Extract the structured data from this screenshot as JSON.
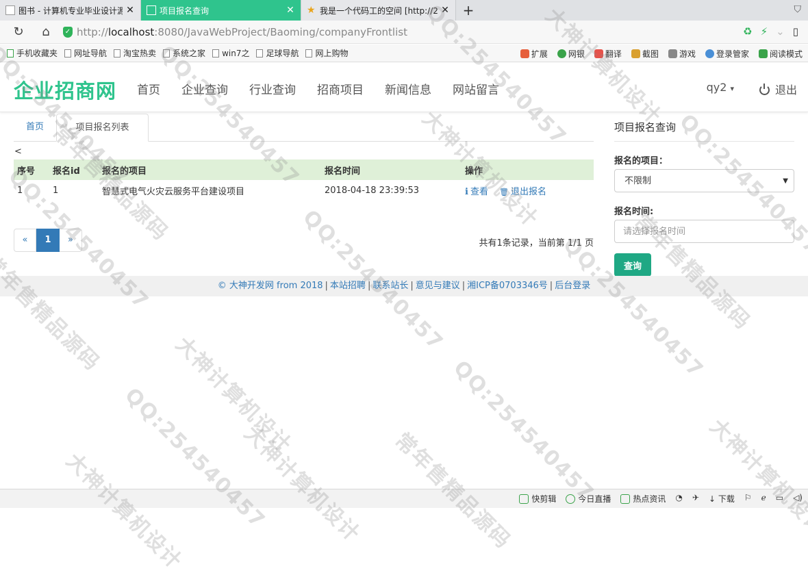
{
  "browser": {
    "tabs": [
      {
        "title": "图书 - 计算机专业毕业设计源码",
        "favicon": "document-icon"
      },
      {
        "title": "项目报名查询",
        "favicon": "page-icon"
      },
      {
        "title": "我是一个代码工的空间 [http://2",
        "favicon": "star-icon"
      }
    ],
    "new_tab": "+",
    "url": {
      "scheme": "http://",
      "host": "localhost",
      "rest": ":8080/JavaWebProject/Baoming/companyFrontlist"
    },
    "bookmarks": [
      "手机收藏夹",
      "网址导航",
      "淘宝热卖",
      "系统之家",
      "win7之",
      "足球导航",
      "网上购物"
    ],
    "toolbar_right": [
      "扩展",
      "网银",
      "翻译",
      "截图",
      "游戏",
      "登录管家",
      "阅读模式"
    ]
  },
  "site": {
    "brand": "企业招商网",
    "nav": [
      "首页",
      "企业查询",
      "行业查询",
      "招商项目",
      "新闻信息",
      "网站留言"
    ],
    "user": "qy2",
    "user_caret": "▾",
    "logout": "退出"
  },
  "content": {
    "tabs": {
      "home": "首页",
      "active": "项目报名列表"
    },
    "lt_text": "<",
    "table": {
      "headers": [
        "序号",
        "报名id",
        "报名的项目",
        "报名时间",
        "操作"
      ],
      "rows": [
        {
          "no": "1",
          "id": "1",
          "project": "智慧式电气火灾云服务平台建设项目",
          "time": "2018-04-18 23:39:53",
          "view_icon": "ℹ",
          "view": "查看",
          "quit_icon": "🗑",
          "quit": "退出报名"
        }
      ]
    },
    "pager": {
      "prev": "«",
      "current": "1",
      "next": "»"
    },
    "page_info": "共有1条记录，当前第 1/1 页"
  },
  "search_panel": {
    "title": "项目报名查询",
    "project_label": "报名的项目：",
    "project_value": "不限制",
    "time_label": "报名时间:",
    "time_placeholder": "请选择报名时间",
    "submit": "查询"
  },
  "footer": [
    "© 大神开发网 from 2018",
    "本站招聘",
    "联系站长",
    "意见与建议",
    "湘ICP备0703346号",
    "后台登录"
  ],
  "statusbar": [
    "快剪辑",
    "今日直播",
    "热点资讯",
    "下载"
  ],
  "watermarks": [
    "大神计算机设计",
    "QQ:254540457",
    "常年售精品源码"
  ],
  "colors": {
    "brand": "#2fc48d",
    "link": "#337ab7",
    "table_header": "#dff0d8",
    "button": "#1fa884"
  }
}
